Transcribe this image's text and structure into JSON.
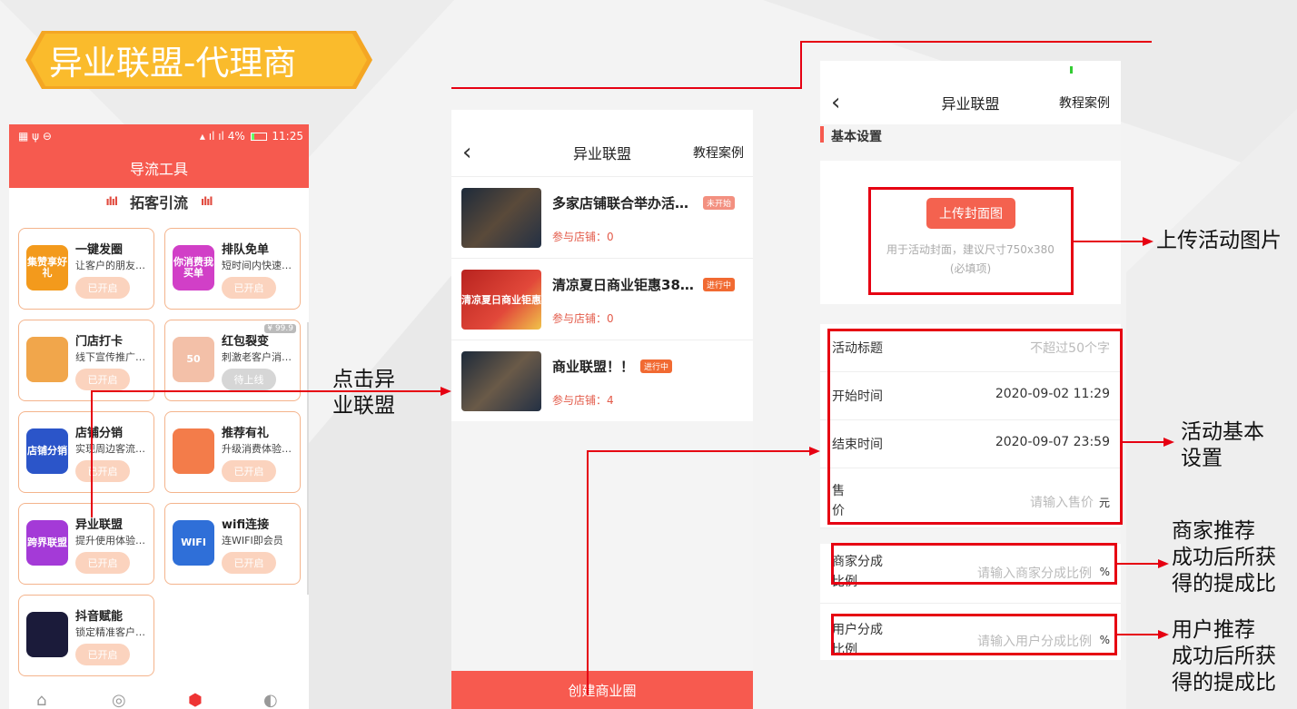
{
  "banner": {
    "title": "异业联盟-代理商"
  },
  "phone1": {
    "status": {
      "time": "11:25",
      "battery": "4%"
    },
    "header": "导流工具",
    "subheader": "拓客引流",
    "tiles": [
      {
        "name": "一键发圈",
        "desc": "让客户的朋友…",
        "btn": "已开启",
        "icon_text": "集赞享好礼",
        "color": "#f39a1c"
      },
      {
        "name": "排队免单",
        "desc": "短时间内快速…",
        "btn": "已开启",
        "icon_text": "你消费我买单",
        "color": "#d13fc7"
      },
      {
        "name": "门店打卡",
        "desc": "线下宣传推广…",
        "btn": "已开启",
        "icon_text": "",
        "color": "#f1a64b"
      },
      {
        "name": "红包裂变",
        "desc": "刺激老客户消…",
        "btn": "待上线",
        "icon_text": "50",
        "color": "#f3c0a8",
        "price": "¥ 99.9"
      },
      {
        "name": "店铺分销",
        "desc": "实现周边客流…",
        "btn": "已开启",
        "icon_text": "店铺分销",
        "color": "#2b55c9"
      },
      {
        "name": "推荐有礼",
        "desc": "升级消费体验…",
        "btn": "已开启",
        "icon_text": "",
        "color": "#f37c4a"
      },
      {
        "name": "异业联盟",
        "desc": "提升使用体验…",
        "btn": "已开启",
        "icon_text": "跨界联盟",
        "color": "#a43ad7"
      },
      {
        "name": "wifi连接",
        "desc": "连WIFI即会员",
        "btn": "已开启",
        "icon_text": "WIFI",
        "color": "#2f6fd8"
      },
      {
        "name": "抖音赋能",
        "desc": "锁定精准客户…",
        "btn": "已开启",
        "icon_text": "",
        "color": "#1b1b3a"
      }
    ]
  },
  "phone2": {
    "title": "异业联盟",
    "link": "教程案例",
    "items": [
      {
        "title": "多家店铺联合举办活…",
        "badge": "未开始",
        "badge_color": "#f39080",
        "shops": "参与店铺：0"
      },
      {
        "title": "清凉夏日商业钜惠38…",
        "badge": "进行中",
        "badge_color": "#f16a32",
        "shops": "参与店铺：0",
        "thumb_text": "清凉夏日商业钜惠"
      },
      {
        "title": "商业联盟！！",
        "badge": "进行中",
        "badge_color": "#f16a32",
        "shops": "参与店铺：4"
      }
    ],
    "button": "创建商业圈"
  },
  "phone3": {
    "title": "异业联盟",
    "link": "教程案例",
    "section": "基本设置",
    "upload_btn": "上传封面图",
    "upload_hint1": "用于活动封面，建议尺寸750x380",
    "upload_hint2": "(必填项)",
    "rows": {
      "title_label": "活动标题",
      "title_ph": "不超过50个字",
      "start_label": "开始时间",
      "start_val": "2020-09-02 11:29",
      "end_label": "结束时间",
      "end_val": "2020-09-07 23:59",
      "price_label1": "售",
      "price_label2": "价",
      "price_ph": "请输入售价",
      "price_unit": "元",
      "merchant_label1": "商家分成",
      "merchant_label2": "比例",
      "merchant_ph": "请输入商家分成比例",
      "merchant_unit": "%",
      "user_label1": "用户分成",
      "user_label2": "比例",
      "user_ph": "请输入用户分成比例",
      "user_unit": "%"
    }
  },
  "notes": {
    "click": [
      "点击异",
      "业联盟"
    ],
    "upload": "上传活动图片",
    "basic": [
      "活动基本",
      "设置"
    ],
    "merchant": [
      "商家推荐",
      "成功后所获",
      "得的提成比"
    ],
    "user": [
      "用户推荐",
      "成功后所获",
      "得的提成比"
    ]
  }
}
